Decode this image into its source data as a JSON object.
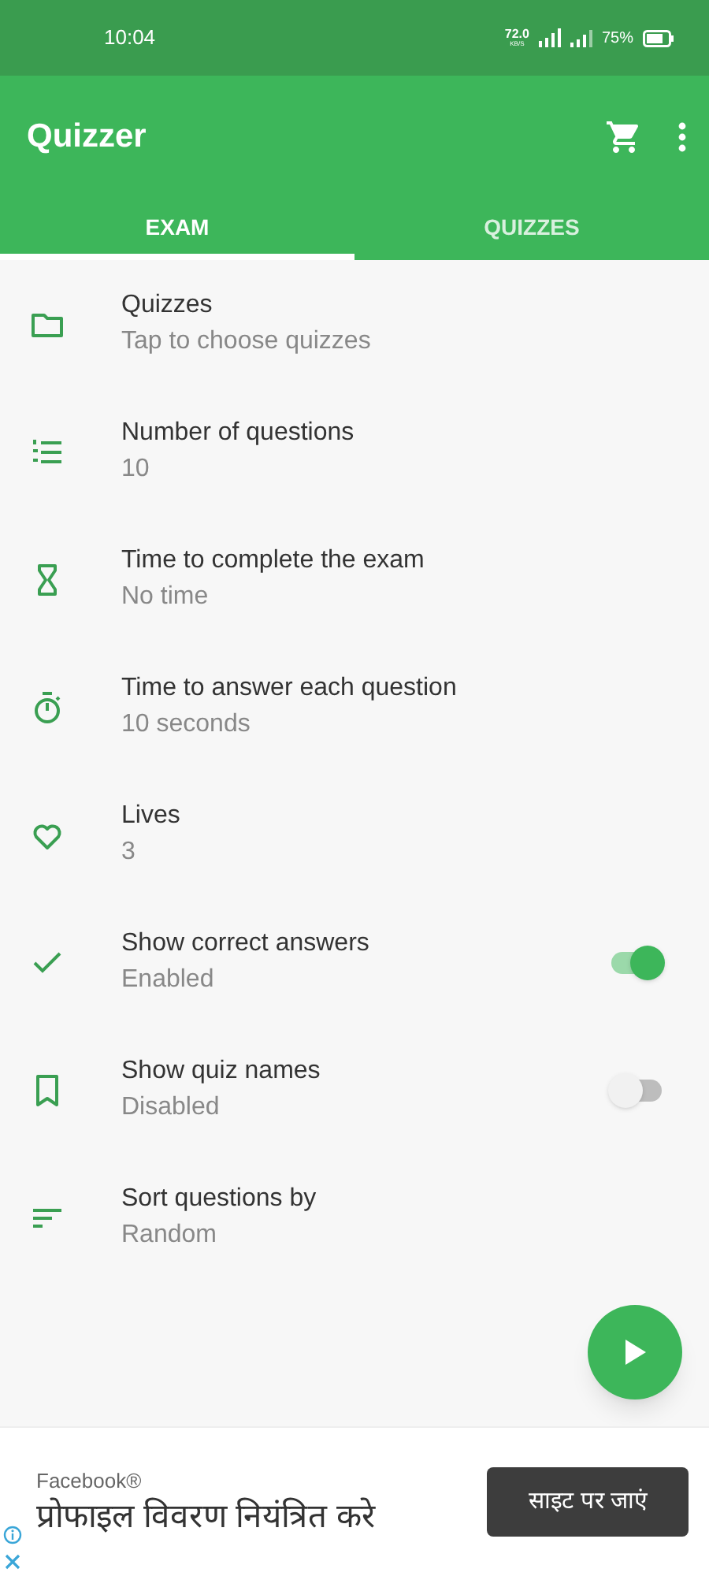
{
  "status_bar": {
    "time": "10:04",
    "speed": "72.0",
    "speed_unit": "KB/S",
    "battery": "75%"
  },
  "app_bar": {
    "title": "Quizzer"
  },
  "tabs": [
    {
      "label": "EXAM",
      "selected": true
    },
    {
      "label": "QUIZZES",
      "selected": false
    }
  ],
  "settings": [
    {
      "kind": "plain",
      "title": "Quizzes",
      "value": "Tap to choose quizzes"
    },
    {
      "kind": "plain",
      "title": "Number of questions",
      "value": "10"
    },
    {
      "kind": "plain",
      "title": "Time to complete the exam",
      "value": "No time"
    },
    {
      "kind": "plain",
      "title": "Time to answer each question",
      "value": "10 seconds"
    },
    {
      "kind": "plain",
      "title": "Lives",
      "value": "3"
    },
    {
      "kind": "toggle",
      "title": "Show correct answers",
      "value": "Enabled",
      "on": true
    },
    {
      "kind": "toggle",
      "title": "Show quiz names",
      "value": "Disabled",
      "on": false
    },
    {
      "kind": "plain",
      "title": "Sort questions by",
      "value": "Random"
    }
  ],
  "ad": {
    "advertiser": "Facebook®",
    "headline": "प्रोफाइल विवरण नियंत्रित करे",
    "button": "साइट पर जाएं"
  }
}
